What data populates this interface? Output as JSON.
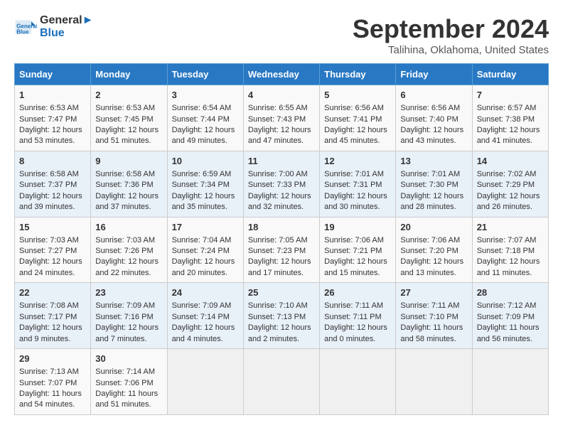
{
  "logo": {
    "line1": "General",
    "line2": "Blue"
  },
  "title": "September 2024",
  "location": "Talihina, Oklahoma, United States",
  "days_header": [
    "Sunday",
    "Monday",
    "Tuesday",
    "Wednesday",
    "Thursday",
    "Friday",
    "Saturday"
  ],
  "weeks": [
    [
      {
        "day": 1,
        "lines": [
          "Sunrise: 6:53 AM",
          "Sunset: 7:47 PM",
          "Daylight: 12 hours",
          "and 53 minutes."
        ]
      },
      {
        "day": 2,
        "lines": [
          "Sunrise: 6:53 AM",
          "Sunset: 7:45 PM",
          "Daylight: 12 hours",
          "and 51 minutes."
        ]
      },
      {
        "day": 3,
        "lines": [
          "Sunrise: 6:54 AM",
          "Sunset: 7:44 PM",
          "Daylight: 12 hours",
          "and 49 minutes."
        ]
      },
      {
        "day": 4,
        "lines": [
          "Sunrise: 6:55 AM",
          "Sunset: 7:43 PM",
          "Daylight: 12 hours",
          "and 47 minutes."
        ]
      },
      {
        "day": 5,
        "lines": [
          "Sunrise: 6:56 AM",
          "Sunset: 7:41 PM",
          "Daylight: 12 hours",
          "and 45 minutes."
        ]
      },
      {
        "day": 6,
        "lines": [
          "Sunrise: 6:56 AM",
          "Sunset: 7:40 PM",
          "Daylight: 12 hours",
          "and 43 minutes."
        ]
      },
      {
        "day": 7,
        "lines": [
          "Sunrise: 6:57 AM",
          "Sunset: 7:38 PM",
          "Daylight: 12 hours",
          "and 41 minutes."
        ]
      }
    ],
    [
      {
        "day": 8,
        "lines": [
          "Sunrise: 6:58 AM",
          "Sunset: 7:37 PM",
          "Daylight: 12 hours",
          "and 39 minutes."
        ]
      },
      {
        "day": 9,
        "lines": [
          "Sunrise: 6:58 AM",
          "Sunset: 7:36 PM",
          "Daylight: 12 hours",
          "and 37 minutes."
        ]
      },
      {
        "day": 10,
        "lines": [
          "Sunrise: 6:59 AM",
          "Sunset: 7:34 PM",
          "Daylight: 12 hours",
          "and 35 minutes."
        ]
      },
      {
        "day": 11,
        "lines": [
          "Sunrise: 7:00 AM",
          "Sunset: 7:33 PM",
          "Daylight: 12 hours",
          "and 32 minutes."
        ]
      },
      {
        "day": 12,
        "lines": [
          "Sunrise: 7:01 AM",
          "Sunset: 7:31 PM",
          "Daylight: 12 hours",
          "and 30 minutes."
        ]
      },
      {
        "day": 13,
        "lines": [
          "Sunrise: 7:01 AM",
          "Sunset: 7:30 PM",
          "Daylight: 12 hours",
          "and 28 minutes."
        ]
      },
      {
        "day": 14,
        "lines": [
          "Sunrise: 7:02 AM",
          "Sunset: 7:29 PM",
          "Daylight: 12 hours",
          "and 26 minutes."
        ]
      }
    ],
    [
      {
        "day": 15,
        "lines": [
          "Sunrise: 7:03 AM",
          "Sunset: 7:27 PM",
          "Daylight: 12 hours",
          "and 24 minutes."
        ]
      },
      {
        "day": 16,
        "lines": [
          "Sunrise: 7:03 AM",
          "Sunset: 7:26 PM",
          "Daylight: 12 hours",
          "and 22 minutes."
        ]
      },
      {
        "day": 17,
        "lines": [
          "Sunrise: 7:04 AM",
          "Sunset: 7:24 PM",
          "Daylight: 12 hours",
          "and 20 minutes."
        ]
      },
      {
        "day": 18,
        "lines": [
          "Sunrise: 7:05 AM",
          "Sunset: 7:23 PM",
          "Daylight: 12 hours",
          "and 17 minutes."
        ]
      },
      {
        "day": 19,
        "lines": [
          "Sunrise: 7:06 AM",
          "Sunset: 7:21 PM",
          "Daylight: 12 hours",
          "and 15 minutes."
        ]
      },
      {
        "day": 20,
        "lines": [
          "Sunrise: 7:06 AM",
          "Sunset: 7:20 PM",
          "Daylight: 12 hours",
          "and 13 minutes."
        ]
      },
      {
        "day": 21,
        "lines": [
          "Sunrise: 7:07 AM",
          "Sunset: 7:18 PM",
          "Daylight: 12 hours",
          "and 11 minutes."
        ]
      }
    ],
    [
      {
        "day": 22,
        "lines": [
          "Sunrise: 7:08 AM",
          "Sunset: 7:17 PM",
          "Daylight: 12 hours",
          "and 9 minutes."
        ]
      },
      {
        "day": 23,
        "lines": [
          "Sunrise: 7:09 AM",
          "Sunset: 7:16 PM",
          "Daylight: 12 hours",
          "and 7 minutes."
        ]
      },
      {
        "day": 24,
        "lines": [
          "Sunrise: 7:09 AM",
          "Sunset: 7:14 PM",
          "Daylight: 12 hours",
          "and 4 minutes."
        ]
      },
      {
        "day": 25,
        "lines": [
          "Sunrise: 7:10 AM",
          "Sunset: 7:13 PM",
          "Daylight: 12 hours",
          "and 2 minutes."
        ]
      },
      {
        "day": 26,
        "lines": [
          "Sunrise: 7:11 AM",
          "Sunset: 7:11 PM",
          "Daylight: 12 hours",
          "and 0 minutes."
        ]
      },
      {
        "day": 27,
        "lines": [
          "Sunrise: 7:11 AM",
          "Sunset: 7:10 PM",
          "Daylight: 11 hours",
          "and 58 minutes."
        ]
      },
      {
        "day": 28,
        "lines": [
          "Sunrise: 7:12 AM",
          "Sunset: 7:09 PM",
          "Daylight: 11 hours",
          "and 56 minutes."
        ]
      }
    ],
    [
      {
        "day": 29,
        "lines": [
          "Sunrise: 7:13 AM",
          "Sunset: 7:07 PM",
          "Daylight: 11 hours",
          "and 54 minutes."
        ]
      },
      {
        "day": 30,
        "lines": [
          "Sunrise: 7:14 AM",
          "Sunset: 7:06 PM",
          "Daylight: 11 hours",
          "and 51 minutes."
        ]
      },
      null,
      null,
      null,
      null,
      null
    ]
  ]
}
